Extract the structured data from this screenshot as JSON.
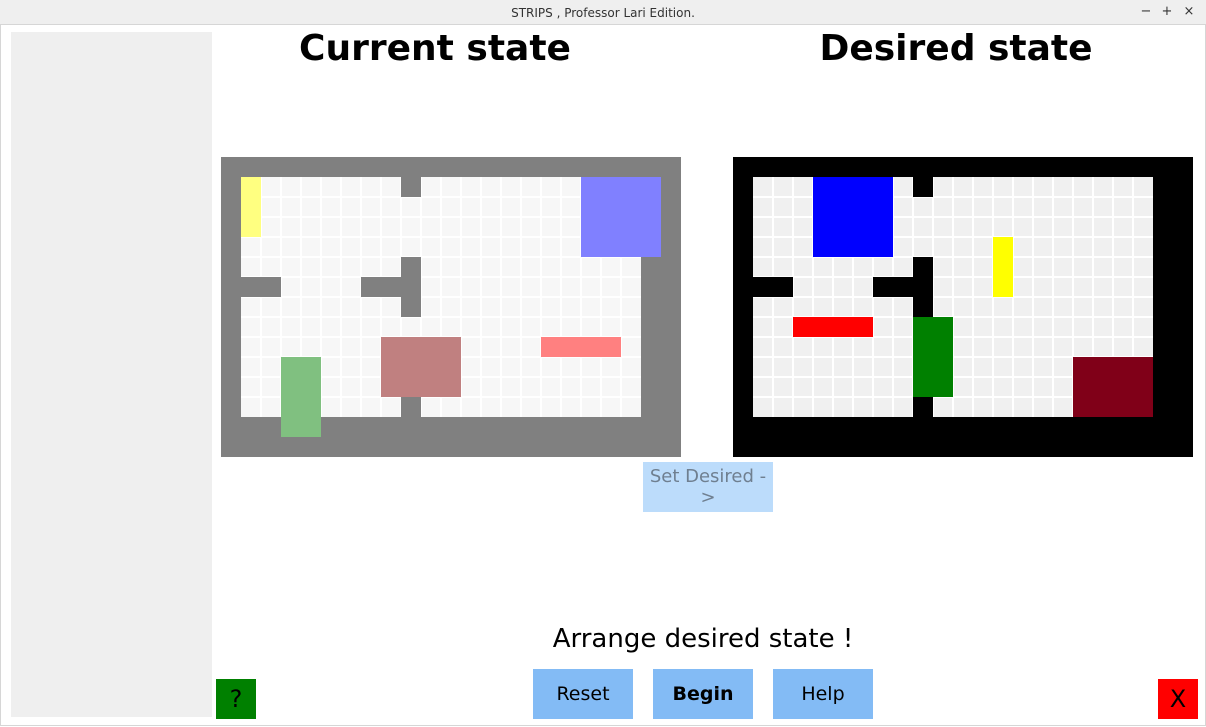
{
  "window": {
    "title": "STRIPS , Professor Lari Edition.",
    "minimize_glyph": "−",
    "maximize_glyph": "+",
    "close_glyph": "×"
  },
  "headings": {
    "current": "Current state",
    "desired": "Desired state"
  },
  "boards": {
    "grid_cols": 20,
    "grid_rows": 12,
    "current": {
      "frame_color": "#808080",
      "floor_color": "#f7f7f7",
      "gridline_color": "#ffffff",
      "walls": [
        [
          8,
          0
        ],
        [
          8,
          5
        ],
        [
          8,
          6
        ],
        [
          8,
          11
        ],
        [
          0,
          5
        ],
        [
          1,
          5
        ],
        [
          6,
          5
        ],
        [
          7,
          5
        ],
        [
          8,
          4
        ]
      ],
      "blocks": [
        {
          "name": "yellow-block",
          "color": "#ffff80",
          "col": 0,
          "row": 0,
          "w": 1,
          "h": 3
        },
        {
          "name": "blue-block",
          "color": "#8080ff",
          "col": 17,
          "row": 0,
          "w": 4,
          "h": 4
        },
        {
          "name": "maroon-block",
          "color": "#c08080",
          "col": 7,
          "row": 8,
          "w": 4,
          "h": 3
        },
        {
          "name": "red-block",
          "color": "#ff8080",
          "col": 15,
          "row": 8,
          "w": 4,
          "h": 1
        },
        {
          "name": "green-block",
          "color": "#80c080",
          "col": 2,
          "row": 9,
          "w": 2,
          "h": 4
        }
      ]
    },
    "desired": {
      "frame_color": "#000000",
      "floor_color": "#f0f0f0",
      "gridline_color": "#ffffff",
      "walls": [
        [
          8,
          0
        ],
        [
          8,
          4
        ],
        [
          8,
          5
        ],
        [
          8,
          6
        ],
        [
          8,
          11
        ],
        [
          0,
          5
        ],
        [
          1,
          5
        ],
        [
          6,
          5
        ],
        [
          7,
          5
        ]
      ],
      "blocks": [
        {
          "name": "blue-block",
          "color": "#0000ff",
          "col": 3,
          "row": 0,
          "w": 4,
          "h": 4
        },
        {
          "name": "yellow-block",
          "color": "#ffff00",
          "col": 12,
          "row": 3,
          "w": 1,
          "h": 3
        },
        {
          "name": "red-block",
          "color": "#ff0000",
          "col": 2,
          "row": 7,
          "w": 4,
          "h": 1
        },
        {
          "name": "green-block",
          "color": "#008000",
          "col": 8,
          "row": 7,
          "w": 2,
          "h": 4
        },
        {
          "name": "maroon-block",
          "color": "#800018",
          "col": 16,
          "row": 9,
          "w": 4,
          "h": 3
        }
      ]
    }
  },
  "set_desired_label": "Set Desired ->",
  "status_text": "Arrange desired state !",
  "buttons": {
    "reset": "Reset",
    "begin": "Begin",
    "help": "Help",
    "question": "?",
    "exit": "X"
  },
  "colors": {
    "action_button": "#83bbf5",
    "set_desired_button": "#bcdcfb",
    "question_button": "#008000",
    "exit_button": "#ff0000",
    "sidebar": "#efefef"
  }
}
